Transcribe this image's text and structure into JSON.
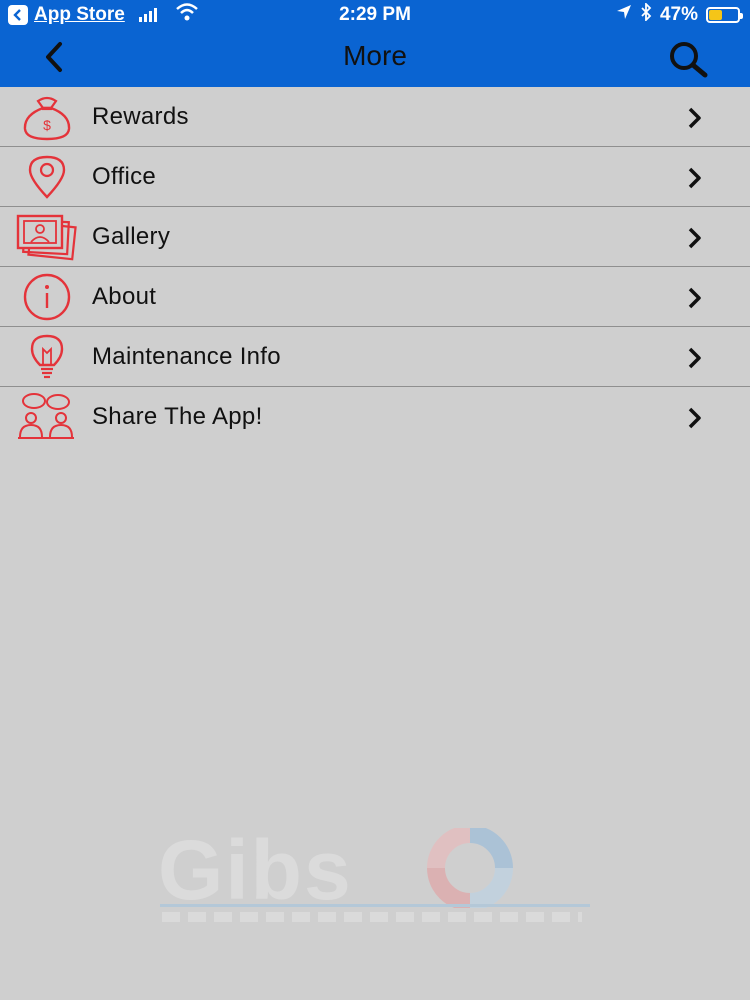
{
  "status_bar": {
    "back_app_label": "App Store",
    "time": "2:29 PM",
    "battery": "47%",
    "battery_level": 0.47,
    "icons": [
      "back-app-icon",
      "signal-icon",
      "wifi-icon",
      "location-icon",
      "bluetooth-icon",
      "battery-icon"
    ]
  },
  "nav": {
    "title": "More",
    "icons": [
      "back-chevron-icon",
      "search-icon"
    ]
  },
  "menu": {
    "items": [
      {
        "label": "Rewards",
        "icon": "money-bag-icon"
      },
      {
        "label": "Office",
        "icon": "location-pin-icon"
      },
      {
        "label": "Gallery",
        "icon": "photos-icon"
      },
      {
        "label": "About",
        "icon": "info-icon"
      },
      {
        "label": "Maintenance Info",
        "icon": "lightbulb-icon"
      },
      {
        "label": "Share The App!",
        "icon": "share-people-icon"
      }
    ]
  },
  "watermark": {
    "logo_text": "Gibs"
  },
  "colors": {
    "nav_blue": "#0a64d2",
    "background": "#cfcfcf",
    "icon_red": "#e4333a",
    "divider": "#8f8f8f"
  }
}
